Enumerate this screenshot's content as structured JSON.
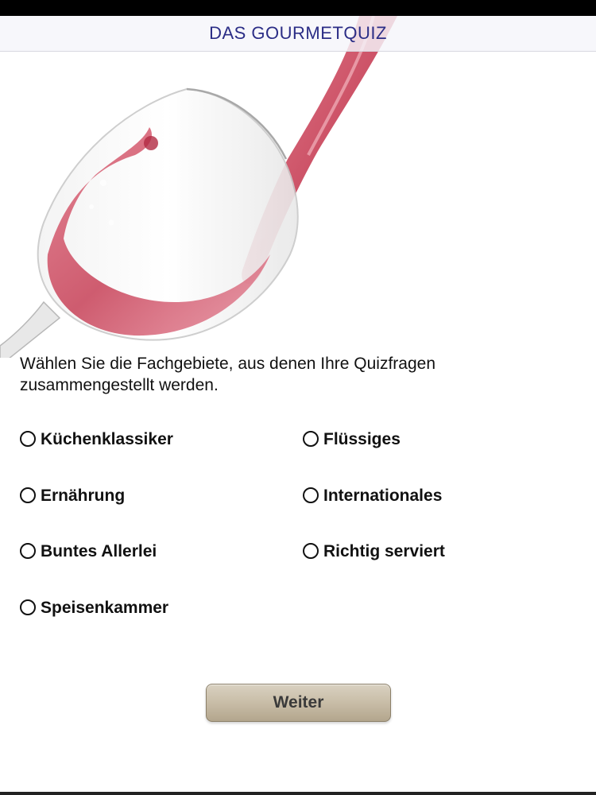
{
  "header": {
    "title": "DAS GOURMETQUIZ"
  },
  "intro": {
    "text": "Wählen Sie die Fachgebiete, aus denen Ihre Quizfragen zusammengestellt werden."
  },
  "options": [
    {
      "label": "Küchenklassiker",
      "selected": false
    },
    {
      "label": "Flüssiges",
      "selected": false
    },
    {
      "label": "Ernährung",
      "selected": false
    },
    {
      "label": "Internationales",
      "selected": false
    },
    {
      "label": "Buntes Allerlei",
      "selected": false
    },
    {
      "label": "Richtig serviert",
      "selected": false
    },
    {
      "label": "Speisenkammer",
      "selected": false
    }
  ],
  "actions": {
    "next_label": "Weiter"
  },
  "colors": {
    "title": "#2b2d86",
    "wine": "#c4354d",
    "button": "#c8bda7"
  }
}
